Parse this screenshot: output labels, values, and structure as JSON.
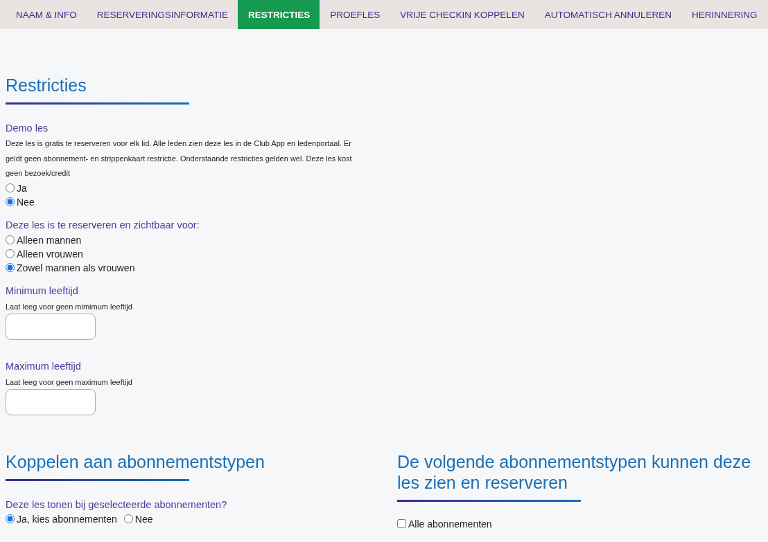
{
  "tabs": [
    {
      "label": "NAAM & INFO",
      "selected": false
    },
    {
      "label": "RESERVERINGSINFORMATIE",
      "selected": false
    },
    {
      "label": "RESTRICTIES",
      "selected": true
    },
    {
      "label": "PROEFLES",
      "selected": false
    },
    {
      "label": "VRIJE CHECKIN KOPPELEN",
      "selected": false
    },
    {
      "label": "AUTOMATISCH ANNULEREN",
      "selected": false
    },
    {
      "label": "HERINNERING",
      "selected": false
    }
  ],
  "restricties": {
    "heading": "Restricties",
    "demo_les": {
      "label": "Demo les",
      "description": "Deze les is gratis te reserveren voor elk lid. Alle leden zien deze les in de Club App en ledenportaal. Er geldt geen abonnement- en strippenkaart restrictie. Onderstaande restricties gelden wel. Deze les kost geen bezoek/credit",
      "options": [
        {
          "label": "Ja",
          "selected": false
        },
        {
          "label": "Nee",
          "selected": true
        }
      ]
    },
    "visibility": {
      "label": "Deze les is te reserveren en zichtbaar voor:",
      "options": [
        {
          "label": "Alleen mannen",
          "selected": false
        },
        {
          "label": "Alleen vrouwen",
          "selected": false
        },
        {
          "label": "Zowel mannen als vrouwen",
          "selected": true
        }
      ]
    },
    "minimum_age": {
      "label": "Minimum leeftijd",
      "hint": "Laat leeg voor geen mimimum leeftijd"
    },
    "maximum_age": {
      "label": "Maximum leeftijd",
      "hint": "Laat leeg voor geen maximum leeftijd"
    }
  },
  "koppelen": {
    "heading": "Koppelen aan abonnementstypen",
    "question": "Deze les tonen bij geselecteerde abonnementen?",
    "options": [
      {
        "label": "Ja, kies abonnementen",
        "selected": true
      },
      {
        "label": "Nee",
        "selected": false
      }
    ]
  },
  "abonnementstypen": {
    "heading": "De volgende abonnementstypen kunnen deze les zien en reserveren",
    "all": {
      "label": "Alle abonnementen",
      "checked": false
    }
  }
}
